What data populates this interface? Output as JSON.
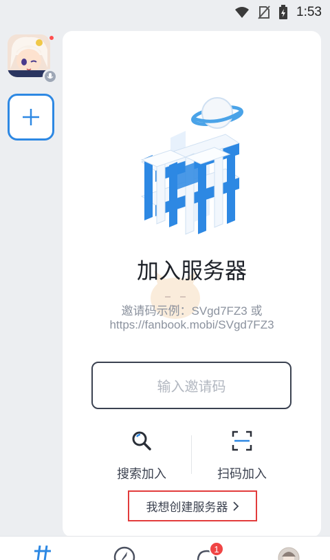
{
  "status_bar": {
    "time": "1:53",
    "icons": [
      "wifi-icon",
      "no-sim-icon",
      "battery-charging-icon"
    ]
  },
  "sidebar": {
    "server_avatar": "server-avatar",
    "add_server_icon": "plus-icon"
  },
  "main": {
    "title": "加入服务器",
    "hint_line1": "邀请码示例：SVgd7FZ3 或",
    "hint_line2": "https://fanbook.mobi/SVgd7FZ3",
    "invite_input": {
      "value": "",
      "placeholder": "输入邀请码"
    },
    "actions": [
      {
        "label": "搜索加入",
        "icon": "search-icon"
      },
      {
        "label": "扫码加入",
        "icon": "scan-icon"
      }
    ],
    "create_link": {
      "label": "我想创建服务器",
      "icon": "chevron-right-icon"
    }
  },
  "bottom_nav": {
    "items": [
      {
        "icon": "hash-icon",
        "active": true
      },
      {
        "icon": "compass-icon"
      },
      {
        "icon": "chat-icon",
        "badge": "1"
      },
      {
        "icon": "profile-avatar"
      }
    ]
  },
  "colors": {
    "accent": "#2d88e3",
    "highlight_border": "#e23b3b",
    "badge": "#f04545"
  }
}
